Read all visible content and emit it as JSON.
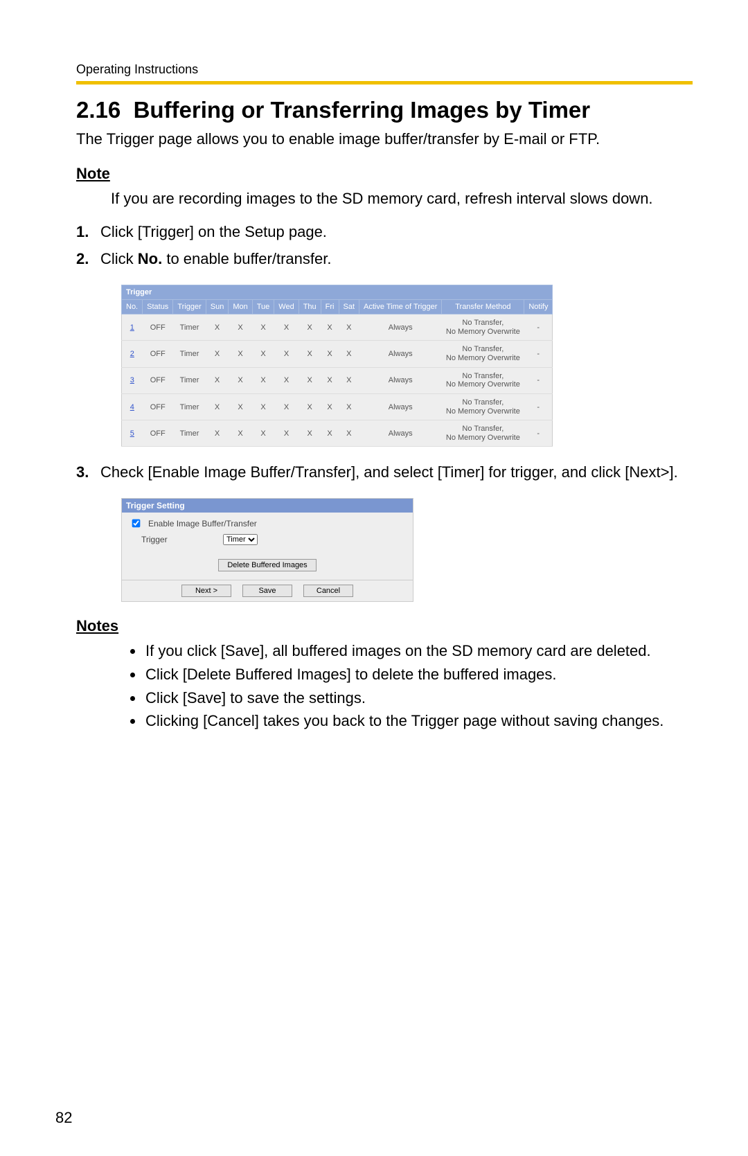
{
  "running_head": "Operating Instructions",
  "section_number": "2.16",
  "section_title": "Buffering or Transferring Images by Timer",
  "intro": "The Trigger page allows you to enable image buffer/transfer by E-mail or FTP.",
  "note_heading": "Note",
  "note_body": "If you are recording images to the SD memory card, refresh interval slows down.",
  "steps": {
    "s1_num": "1.",
    "s1_text": "Click [Trigger] on the Setup page.",
    "s2_num": "2.",
    "s2_pre": "Click ",
    "s2_bold": "No.",
    "s2_post": " to enable buffer/transfer.",
    "s3_num": "3.",
    "s3_text": "Check [Enable Image Buffer/Transfer], and select [Timer] for trigger, and click [Next>]."
  },
  "trigger_table": {
    "title": "Trigger",
    "headers": [
      "No.",
      "Status",
      "Trigger",
      "Sun",
      "Mon",
      "Tue",
      "Wed",
      "Thu",
      "Fri",
      "Sat",
      "Active Time of Trigger",
      "Transfer Method",
      "Notify"
    ],
    "rows": [
      {
        "no": "1",
        "status": "OFF",
        "trigger": "Timer",
        "d": [
          "X",
          "X",
          "X",
          "X",
          "X",
          "X",
          "X"
        ],
        "active": "Always",
        "method": "No Transfer, No Memory Overwrite",
        "notify": "-"
      },
      {
        "no": "2",
        "status": "OFF",
        "trigger": "Timer",
        "d": [
          "X",
          "X",
          "X",
          "X",
          "X",
          "X",
          "X"
        ],
        "active": "Always",
        "method": "No Transfer, No Memory Overwrite",
        "notify": "-"
      },
      {
        "no": "3",
        "status": "OFF",
        "trigger": "Timer",
        "d": [
          "X",
          "X",
          "X",
          "X",
          "X",
          "X",
          "X"
        ],
        "active": "Always",
        "method": "No Transfer, No Memory Overwrite",
        "notify": "-"
      },
      {
        "no": "4",
        "status": "OFF",
        "trigger": "Timer",
        "d": [
          "X",
          "X",
          "X",
          "X",
          "X",
          "X",
          "X"
        ],
        "active": "Always",
        "method": "No Transfer, No Memory Overwrite",
        "notify": "-"
      },
      {
        "no": "5",
        "status": "OFF",
        "trigger": "Timer",
        "d": [
          "X",
          "X",
          "X",
          "X",
          "X",
          "X",
          "X"
        ],
        "active": "Always",
        "method": "No Transfer, No Memory Overwrite",
        "notify": "-"
      }
    ]
  },
  "trigger_setting": {
    "title": "Trigger Setting",
    "checkbox_label": "Enable Image Buffer/Transfer",
    "trigger_label": "Trigger",
    "select_value": "Timer",
    "delete_btn": "Delete Buffered Images",
    "next_btn": "Next >",
    "save_btn": "Save",
    "cancel_btn": "Cancel"
  },
  "notes_heading": "Notes",
  "notes": [
    "If you click [Save], all buffered images on the SD memory card are deleted.",
    "Click [Delete Buffered Images] to delete the buffered images.",
    "Click [Save] to save the settings.",
    "Clicking [Cancel] takes you back to the Trigger page without saving changes."
  ],
  "page_number": "82"
}
